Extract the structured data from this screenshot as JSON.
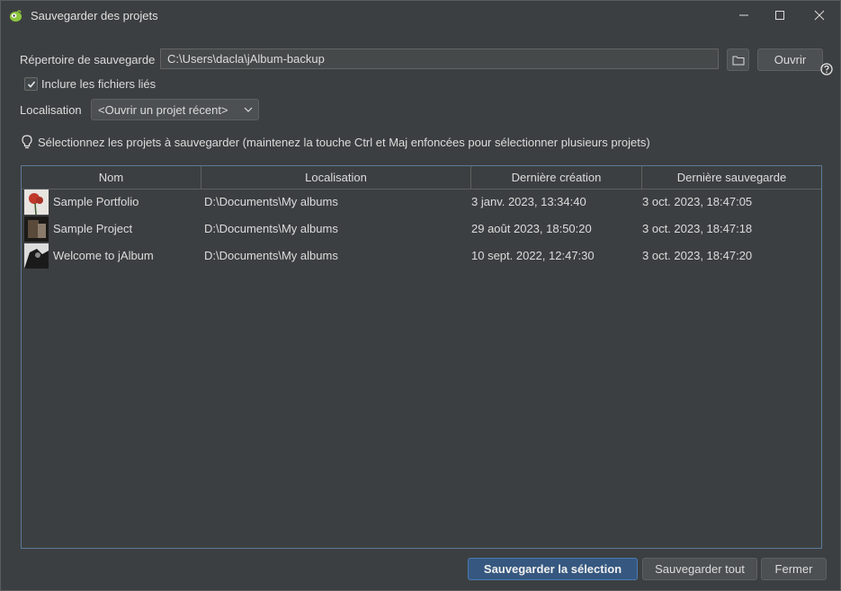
{
  "window": {
    "title": "Sauvegarder des projets"
  },
  "form": {
    "dir_label": "Répertoire de sauvegarde",
    "dir_value": "C:\\Users\\dacla\\jAlbum-backup",
    "open_label": "Ouvrir",
    "include_linked_label": "Inclure les fichiers liés",
    "include_linked_checked": true,
    "location_label": "Localisation",
    "location_selected": "<Ouvrir un projet récent>"
  },
  "hint": "Sélectionnez les projets à sauvegarder (maintenez la touche Ctrl et Maj enfoncées pour sélectionner plusieurs projets)",
  "table": {
    "columns": [
      "Nom",
      "Localisation",
      "Dernière création",
      "Dernière sauvegarde"
    ],
    "rows": [
      {
        "name": "Sample Portfolio",
        "location": "D:\\Documents\\My albums",
        "created": "3 janv. 2023, 13:34:40",
        "saved": "3 oct. 2023, 18:47:05",
        "thumb_color": "#c0392b"
      },
      {
        "name": "Sample Project",
        "location": "D:\\Documents\\My albums",
        "created": "29 août 2023, 18:50:20",
        "saved": "3 oct. 2023, 18:47:18",
        "thumb_color": "#5a4a3a"
      },
      {
        "name": "Welcome to jAlbum",
        "location": "D:\\Documents\\My albums",
        "created": "10 sept. 2022, 12:47:30",
        "saved": "3 oct. 2023, 18:47:20",
        "thumb_color": "#2a2a2a"
      }
    ]
  },
  "buttons": {
    "save_selection": "Sauvegarder la sélection",
    "save_all": "Sauvegarder tout",
    "close": "Fermer"
  },
  "colors": {
    "accent": "#365880",
    "background": "#3c3f41",
    "table_border": "#5b7a99"
  }
}
